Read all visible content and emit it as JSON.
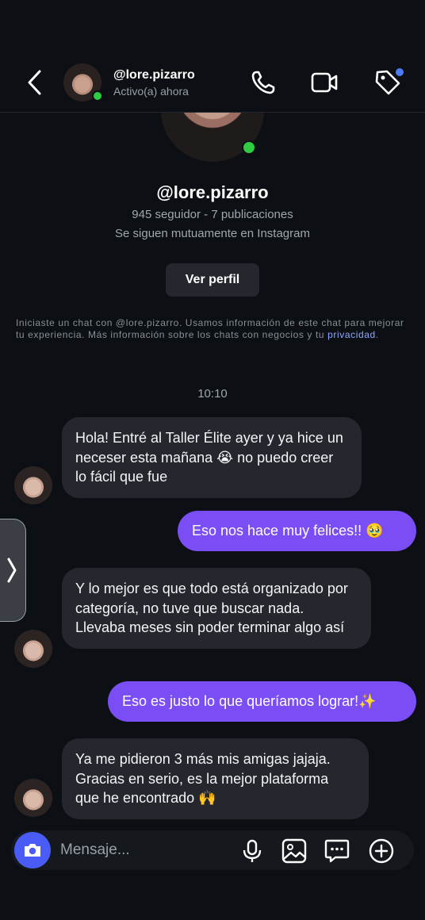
{
  "header": {
    "username": "@lore.pizarro",
    "status": "Activo(a) ahora"
  },
  "profile": {
    "name": "@lore.pizarro",
    "stats": "945 seguidor - 7 publicaciones",
    "mutual": "Se siguen mutuamente en Instagram",
    "view_profile_label": "Ver perfil"
  },
  "disclaimer": {
    "text": "Iniciaste un chat con @lore.pizarro. Usamos información de este chat para mejorar tu experiencia. Más información sobre los chats con negocios y tu ",
    "link": "privacidad",
    "end": "."
  },
  "timestamp": "10:10",
  "messages": [
    {
      "from": "them",
      "text": "Hola! Entré al Taller Élite ayer y ya hice un neceser esta mañana 😭 no puedo creer lo fácil que fue"
    },
    {
      "from": "me",
      "text": "Eso nos hace muy felices!! 🥹"
    },
    {
      "from": "them",
      "text": "Y lo mejor es que todo está organizado por categoría, no tuve que buscar nada. Llevaba meses sin poder terminar algo así"
    },
    {
      "from": "me",
      "text": "Eso es justo lo que queríamos lograr!✨"
    },
    {
      "from": "them",
      "text": "Ya me pidieron 3 más mis amigas jajaja. Gracias en serio, es la mejor plataforma que he encontrado 🙌"
    }
  ],
  "composer": {
    "placeholder": "Mensaje..."
  },
  "colors": {
    "background": "#0c0f14",
    "incoming_bubble": "#24272d",
    "outgoing_bubble": "#7b4df5",
    "camera_button": "#4a5cf5",
    "online": "#2ecc40",
    "link": "#8fa8ff"
  },
  "icons": [
    "back-chevron-icon",
    "phone-icon",
    "video-camera-icon",
    "tag-icon",
    "camera-icon",
    "microphone-icon",
    "image-icon",
    "chat-bubble-icon",
    "plus-circle-icon",
    "chevron-right-icon"
  ]
}
